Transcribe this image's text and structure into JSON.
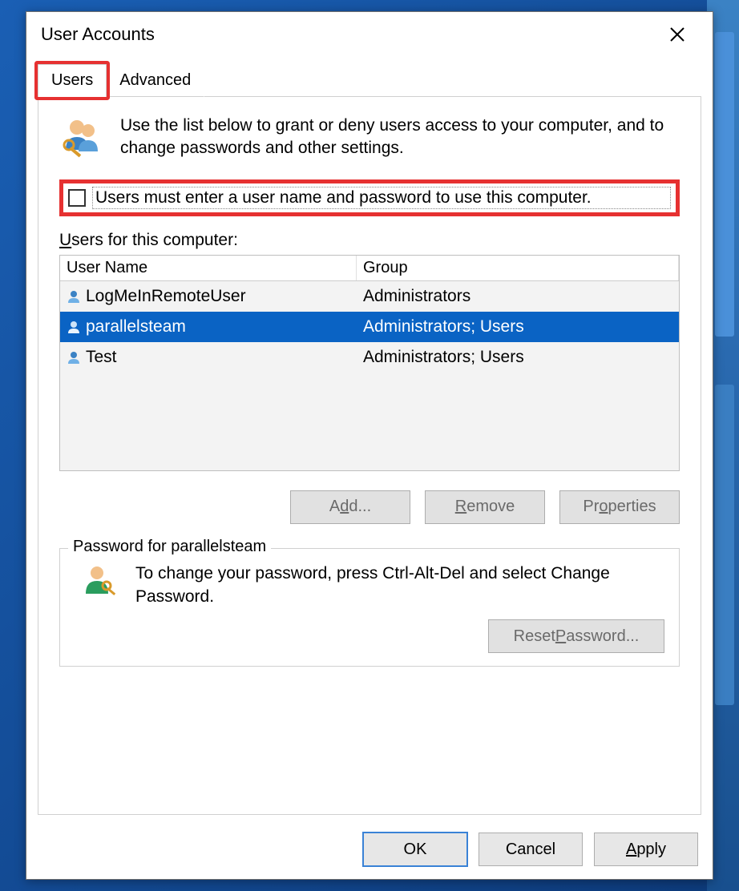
{
  "dialog": {
    "title": "User Accounts"
  },
  "tabs": {
    "users": "Users",
    "advanced": "Advanced"
  },
  "intro": "Use the list below to grant or deny users access to your computer, and to change passwords and other settings.",
  "checkbox": {
    "label": "Users must enter a user name and password to use this computer.",
    "checked": false
  },
  "list": {
    "caption_prefix": "U",
    "caption_rest": "sers for this computer:",
    "headers": {
      "name": "User Name",
      "group": "Group"
    },
    "rows": [
      {
        "name": "LogMeInRemoteUser",
        "group": "Administrators",
        "selected": false
      },
      {
        "name": "parallelsteam",
        "group": "Administrators; Users",
        "selected": true
      },
      {
        "name": "Test",
        "group": "Administrators; Users",
        "selected": false
      }
    ]
  },
  "actions": {
    "add_pre": "A",
    "add_ul": "d",
    "add_post": "d...",
    "remove_pre": "",
    "remove_ul": "R",
    "remove_post": "emove",
    "properties_pre": "Pr",
    "properties_ul": "o",
    "properties_post": "perties"
  },
  "password_box": {
    "legend": "Password for parallelsteam",
    "text": "To change your password, press Ctrl-Alt-Del and select Change Password.",
    "reset_pre": "Reset ",
    "reset_ul": "P",
    "reset_post": "assword..."
  },
  "bottom": {
    "ok": "OK",
    "cancel": "Cancel",
    "apply_pre": "",
    "apply_ul": "A",
    "apply_post": "pply"
  }
}
